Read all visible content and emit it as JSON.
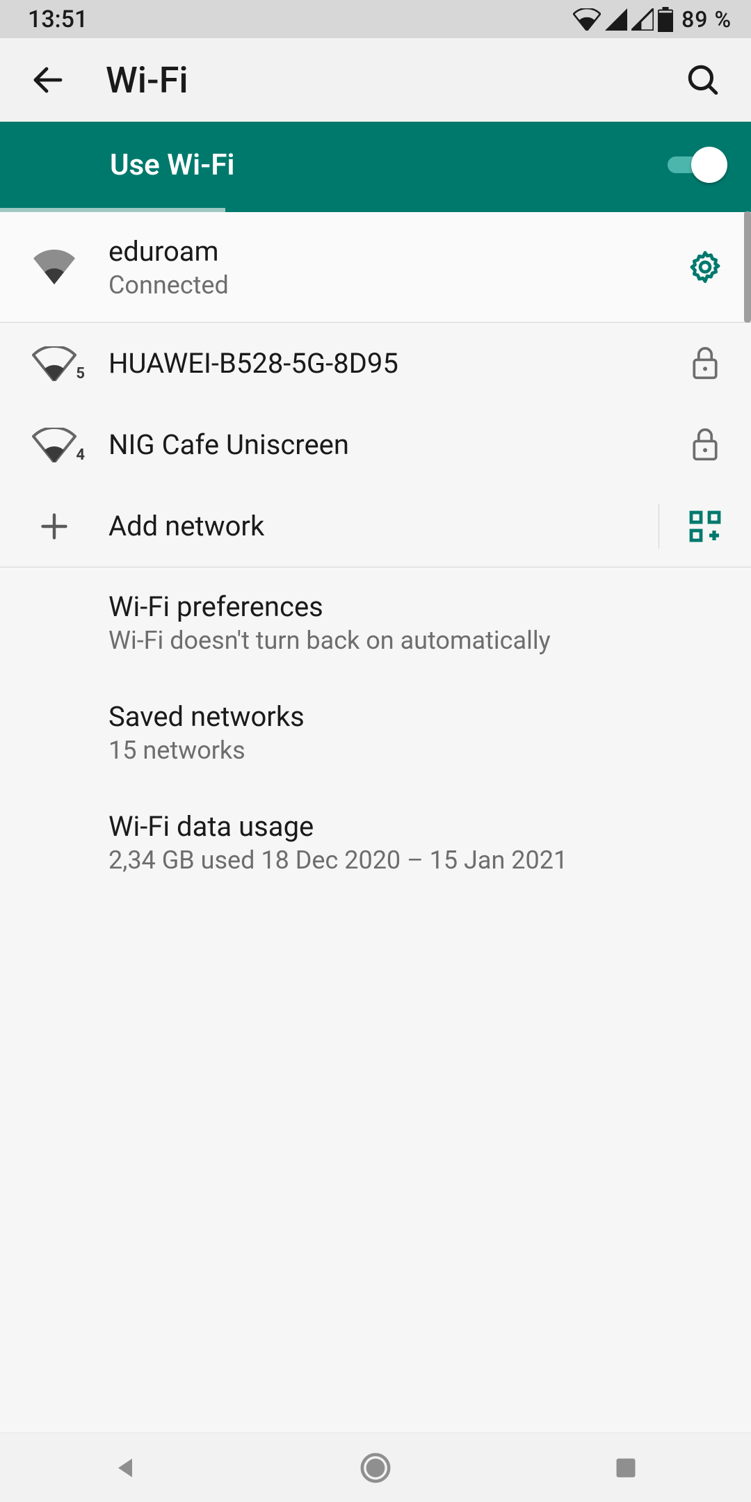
{
  "status": {
    "time": "13:51",
    "battery": "89 %"
  },
  "header": {
    "title": "Wi-Fi"
  },
  "toggle": {
    "label": "Use Wi-Fi",
    "on": true
  },
  "connected_network": {
    "ssid": "eduroam",
    "status": "Connected"
  },
  "networks": [
    {
      "ssid": "HUAWEI-B528-5G-8D95",
      "secured": true,
      "band": "5"
    },
    {
      "ssid": "NIG Cafe Uniscreen",
      "secured": true,
      "band": "4"
    }
  ],
  "add_network_label": "Add network",
  "preferences": {
    "wifi_prefs": {
      "title": "Wi-Fi preferences",
      "subtitle": "Wi-Fi doesn't turn back on automatically"
    },
    "saved_networks": {
      "title": "Saved networks",
      "subtitle": "15 networks"
    },
    "data_usage": {
      "title": "Wi-Fi data usage",
      "subtitle": "2,34 GB used 18 Dec 2020 – 15 Jan 2021"
    }
  },
  "colors": {
    "accent": "#00796d"
  }
}
